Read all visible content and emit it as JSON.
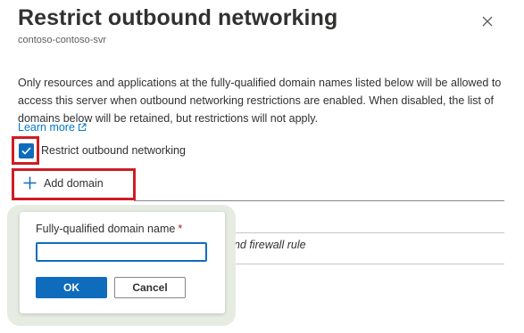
{
  "panel": {
    "title": "Restrict outbound networking",
    "server_name": "contoso-contoso-svr",
    "description": "Only resources and applications at the fully-qualified domain names listed below will be allowed to access this server when outbound networking restrictions are enabled. When disabled, the list of domains below will be retained, but restrictions will not apply.",
    "learn_more_label": "Learn more",
    "close_icon": "close-icon"
  },
  "restrict_checkbox": {
    "label": "Restrict outbound networking",
    "checked": true
  },
  "add_domain": {
    "label": "Add domain",
    "icon": "plus-icon"
  },
  "table": {
    "empty_row_text": "und firewall rule"
  },
  "popup": {
    "field_label": "Fully-qualified domain name",
    "required_marker": "*",
    "input_value": "",
    "ok_label": "OK",
    "cancel_label": "Cancel"
  },
  "colors": {
    "accent": "#0f6cbd",
    "highlight": "#d01c24",
    "link": "#0078d4"
  }
}
